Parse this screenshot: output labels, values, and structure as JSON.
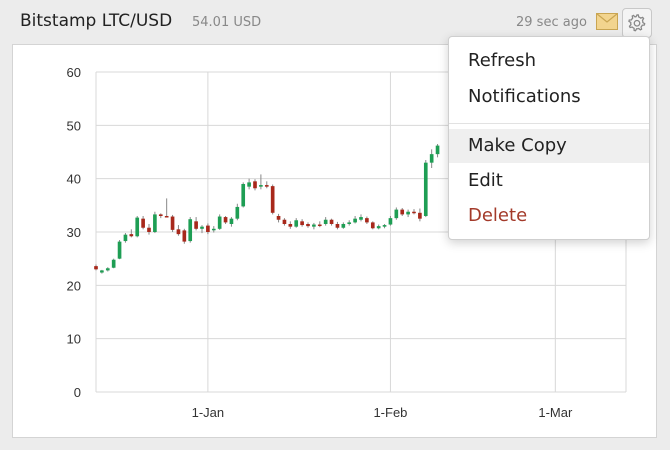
{
  "widget": {
    "title": "Bitstamp LTC/USD",
    "price": "54.01 USD",
    "updated": "29 sec ago",
    "icons": [
      "mail-icon",
      "gear-icon"
    ]
  },
  "menu": {
    "items": [
      {
        "label": "Refresh",
        "style": "normal"
      },
      {
        "label": "Notifications",
        "style": "normal"
      },
      {
        "label": "Make Copy",
        "style": "hover"
      },
      {
        "label": "Edit",
        "style": "normal"
      },
      {
        "label": "Delete",
        "style": "danger"
      }
    ]
  },
  "colors": {
    "up": "#1e9e54",
    "down": "#a8281b",
    "neutral": "#888888",
    "grid": "#d8d8d8",
    "delete": "#a33a2a"
  },
  "chart_data": {
    "type": "candlestick",
    "ylim": [
      0,
      60
    ],
    "yticks": [
      0,
      10,
      20,
      30,
      40,
      50,
      60
    ],
    "xtick_labels": [
      "1-Jan",
      "1-Feb",
      "1-Mar"
    ],
    "xtick_days": [
      0,
      31,
      59
    ],
    "xlim_days": [
      -19,
      71
    ],
    "grid": true,
    "candles": [
      {
        "d": -19,
        "o": 23.6,
        "h": 23.9,
        "l": 22.8,
        "c": 23.0
      },
      {
        "d": -18,
        "o": 22.4,
        "h": 22.9,
        "l": 22.2,
        "c": 22.8
      },
      {
        "d": -17,
        "o": 22.8,
        "h": 23.4,
        "l": 22.6,
        "c": 23.2
      },
      {
        "d": -16,
        "o": 23.3,
        "h": 25.0,
        "l": 23.2,
        "c": 24.8
      },
      {
        "d": -15,
        "o": 25.0,
        "h": 28.5,
        "l": 24.9,
        "c": 28.2
      },
      {
        "d": -14,
        "o": 28.3,
        "h": 29.8,
        "l": 28.0,
        "c": 29.5
      },
      {
        "d": -13,
        "o": 29.6,
        "h": 30.5,
        "l": 29.0,
        "c": 29.2
      },
      {
        "d": -12,
        "o": 29.2,
        "h": 33.0,
        "l": 29.0,
        "c": 32.7
      },
      {
        "d": -11,
        "o": 32.5,
        "h": 33.0,
        "l": 30.5,
        "c": 30.8
      },
      {
        "d": -10,
        "o": 30.8,
        "h": 31.5,
        "l": 29.5,
        "c": 30.0
      },
      {
        "d": -9,
        "o": 30.0,
        "h": 33.8,
        "l": 29.8,
        "c": 33.3
      },
      {
        "d": -8,
        "o": 33.3,
        "h": 33.5,
        "l": 32.6,
        "c": 33.0
      },
      {
        "d": -7,
        "o": 33.0,
        "h": 36.3,
        "l": 32.8,
        "c": 32.9
      },
      {
        "d": -6,
        "o": 32.9,
        "h": 33.2,
        "l": 30.0,
        "c": 30.4
      },
      {
        "d": -5,
        "o": 30.5,
        "h": 31.3,
        "l": 29.3,
        "c": 29.6
      },
      {
        "d": -4,
        "o": 30.3,
        "h": 30.6,
        "l": 27.8,
        "c": 28.2
      },
      {
        "d": -3,
        "o": 28.3,
        "h": 32.8,
        "l": 28.0,
        "c": 32.4
      },
      {
        "d": -2,
        "o": 32.0,
        "h": 32.8,
        "l": 30.3,
        "c": 30.6
      },
      {
        "d": -1,
        "o": 30.6,
        "h": 31.3,
        "l": 29.8,
        "c": 31.0
      },
      {
        "d": 0,
        "o": 31.2,
        "h": 31.6,
        "l": 29.6,
        "c": 30.0
      },
      {
        "d": 1,
        "o": 30.4,
        "h": 31.1,
        "l": 29.9,
        "c": 30.6
      },
      {
        "d": 2,
        "o": 30.6,
        "h": 33.3,
        "l": 30.4,
        "c": 32.9
      },
      {
        "d": 3,
        "o": 32.8,
        "h": 33.0,
        "l": 31.5,
        "c": 31.8
      },
      {
        "d": 4,
        "o": 31.5,
        "h": 32.8,
        "l": 31.0,
        "c": 32.5
      },
      {
        "d": 5,
        "o": 32.5,
        "h": 35.3,
        "l": 32.2,
        "c": 34.7
      },
      {
        "d": 6,
        "o": 34.8,
        "h": 39.3,
        "l": 34.6,
        "c": 39.0
      },
      {
        "d": 7,
        "o": 38.5,
        "h": 40.0,
        "l": 38.0,
        "c": 39.3
      },
      {
        "d": 8,
        "o": 39.5,
        "h": 39.9,
        "l": 37.8,
        "c": 38.2
      },
      {
        "d": 9,
        "o": 38.5,
        "h": 40.8,
        "l": 38.0,
        "c": 38.8
      },
      {
        "d": 10,
        "o": 38.8,
        "h": 39.5,
        "l": 38.2,
        "c": 38.5
      },
      {
        "d": 11,
        "o": 38.6,
        "h": 38.9,
        "l": 33.3,
        "c": 33.6
      },
      {
        "d": 12,
        "o": 33.0,
        "h": 33.4,
        "l": 31.8,
        "c": 32.3
      },
      {
        "d": 13,
        "o": 32.3,
        "h": 32.6,
        "l": 31.2,
        "c": 31.5
      },
      {
        "d": 14,
        "o": 31.5,
        "h": 32.0,
        "l": 30.6,
        "c": 31.0
      },
      {
        "d": 15,
        "o": 31.0,
        "h": 32.6,
        "l": 30.8,
        "c": 32.2
      },
      {
        "d": 16,
        "o": 32.0,
        "h": 32.4,
        "l": 31.0,
        "c": 31.3
      },
      {
        "d": 17,
        "o": 31.5,
        "h": 31.8,
        "l": 30.8,
        "c": 31.1
      },
      {
        "d": 18,
        "o": 31.0,
        "h": 31.7,
        "l": 30.5,
        "c": 31.4
      },
      {
        "d": 19,
        "o": 31.4,
        "h": 32.0,
        "l": 30.9,
        "c": 31.2
      },
      {
        "d": 20,
        "o": 31.5,
        "h": 32.8,
        "l": 31.2,
        "c": 32.3
      },
      {
        "d": 21,
        "o": 32.3,
        "h": 32.5,
        "l": 31.2,
        "c": 31.5
      },
      {
        "d": 22,
        "o": 31.5,
        "h": 31.9,
        "l": 30.5,
        "c": 30.8
      },
      {
        "d": 23,
        "o": 30.8,
        "h": 31.8,
        "l": 30.6,
        "c": 31.5
      },
      {
        "d": 24,
        "o": 31.5,
        "h": 32.2,
        "l": 31.2,
        "c": 31.8
      },
      {
        "d": 25,
        "o": 31.8,
        "h": 33.0,
        "l": 31.6,
        "c": 32.5
      },
      {
        "d": 26,
        "o": 32.3,
        "h": 33.3,
        "l": 32.0,
        "c": 32.8
      },
      {
        "d": 27,
        "o": 32.6,
        "h": 32.9,
        "l": 31.5,
        "c": 31.8
      },
      {
        "d": 28,
        "o": 31.8,
        "h": 32.0,
        "l": 30.5,
        "c": 30.7
      },
      {
        "d": 29,
        "o": 30.7,
        "h": 31.4,
        "l": 30.5,
        "c": 31.1
      },
      {
        "d": 30,
        "o": 31.0,
        "h": 31.5,
        "l": 30.7,
        "c": 31.3
      },
      {
        "d": 31,
        "o": 31.4,
        "h": 33.0,
        "l": 31.2,
        "c": 32.6
      },
      {
        "d": 32,
        "o": 32.6,
        "h": 34.6,
        "l": 32.3,
        "c": 34.2
      },
      {
        "d": 33,
        "o": 34.2,
        "h": 34.5,
        "l": 33.0,
        "c": 33.3
      },
      {
        "d": 34,
        "o": 33.3,
        "h": 34.2,
        "l": 32.8,
        "c": 33.8
      },
      {
        "d": 35,
        "o": 33.8,
        "h": 34.3,
        "l": 33.3,
        "c": 33.6
      },
      {
        "d": 36,
        "o": 33.6,
        "h": 34.4,
        "l": 32.0,
        "c": 32.5
      },
      {
        "d": 37,
        "o": 33.0,
        "h": 43.5,
        "l": 32.8,
        "c": 43.0
      },
      {
        "d": 38,
        "o": 43.0,
        "h": 45.5,
        "l": 42.0,
        "c": 44.6
      },
      {
        "d": 39,
        "o": 44.6,
        "h": 46.5,
        "l": 44.0,
        "c": 46.2
      }
    ]
  }
}
